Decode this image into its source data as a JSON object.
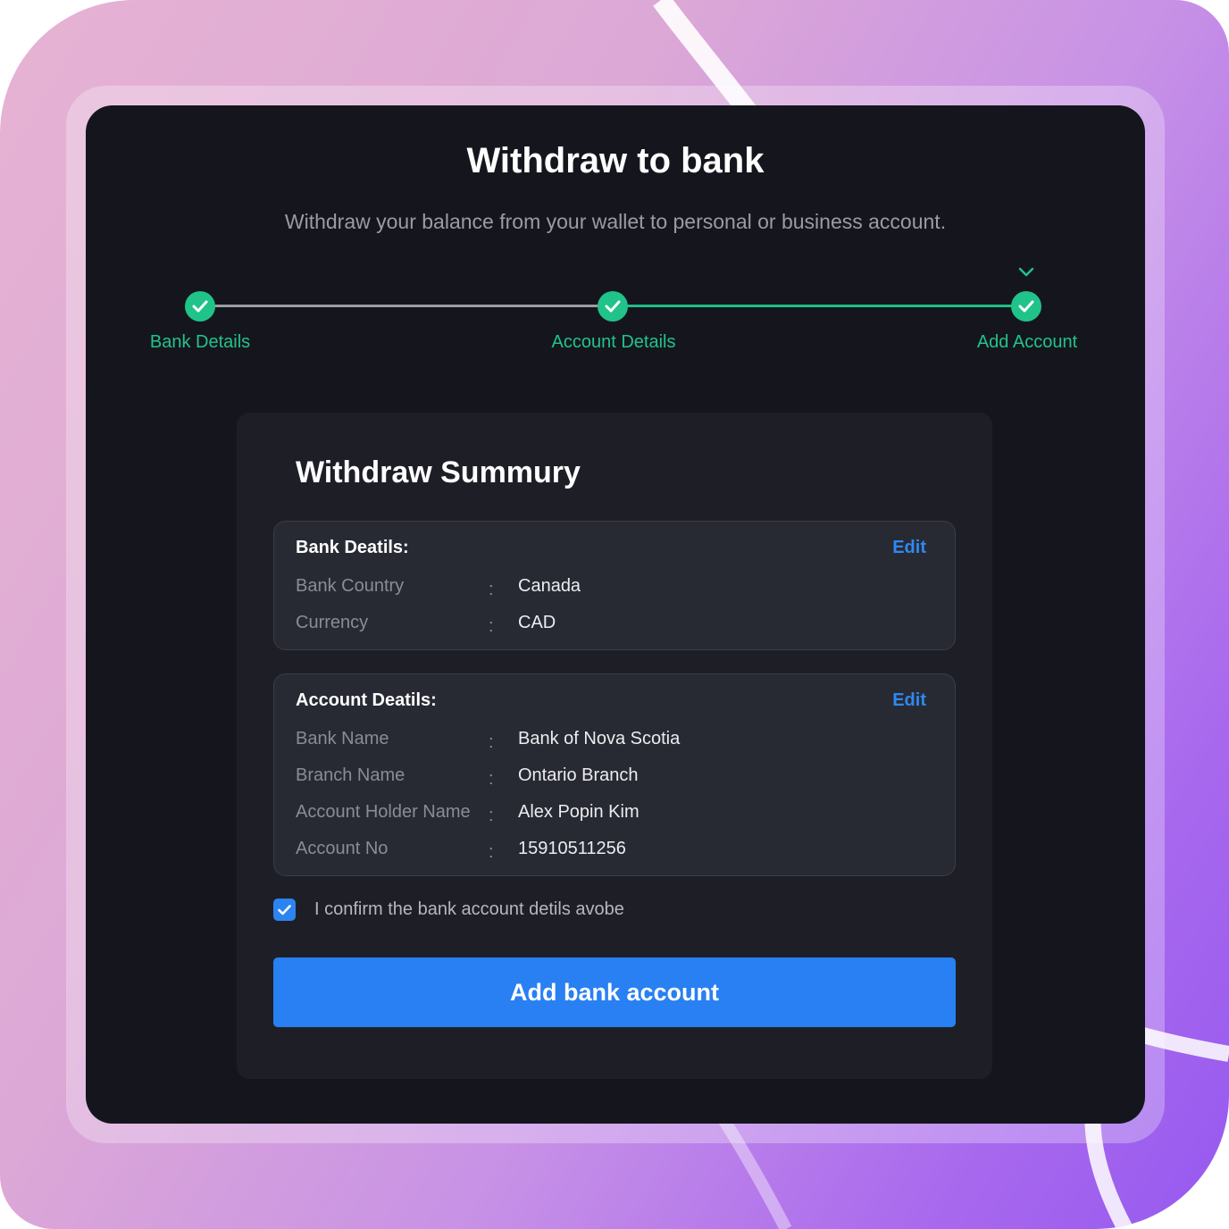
{
  "header": {
    "title": "Withdraw to bank",
    "subtitle": "Withdraw your balance from your wallet to personal or business account."
  },
  "stepper": {
    "steps": [
      {
        "label": "Bank Details",
        "status": "complete"
      },
      {
        "label": "Account Details",
        "status": "complete"
      },
      {
        "label": "Add Account",
        "status": "complete",
        "current": true
      }
    ]
  },
  "summary": {
    "title": "Withdraw Summury",
    "bank_details": {
      "heading": "Bank Deatils:",
      "edit_label": "Edit",
      "rows": [
        {
          "label": "Bank Country",
          "value": "Canada"
        },
        {
          "label": "Currency",
          "value": "CAD"
        }
      ]
    },
    "account_details": {
      "heading": "Account Deatils:",
      "edit_label": "Edit",
      "rows": [
        {
          "label": "Bank Name",
          "value": "Bank of Nova Scotia"
        },
        {
          "label": "Branch Name",
          "value": "Ontario Branch"
        },
        {
          "label": "Account Holder Name",
          "value": "Alex Popin Kim"
        },
        {
          "label": "Account No",
          "value": "15910511256"
        }
      ]
    },
    "separator": ":",
    "confirm": {
      "checked": true,
      "label": "I confirm the bank account detils avobe"
    },
    "submit_label": "Add bank account"
  },
  "colors": {
    "accent_blue": "#2880f2",
    "success_green": "#20c38a",
    "window_bg": "#15161d",
    "card_bg": "#1e1f26"
  },
  "icons": {
    "step_complete": "check-icon",
    "current_step_marker": "chevron-down-icon",
    "checkbox": "check-icon"
  }
}
